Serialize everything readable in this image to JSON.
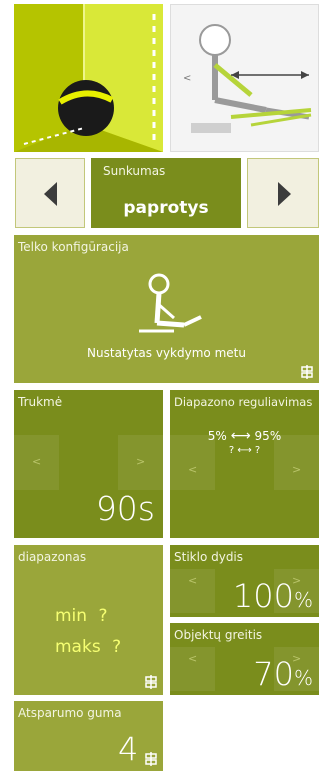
{
  "top_images": {
    "left_alt": "yellow-room-ball-illustration",
    "right_alt": "stick-figure-seated-exercise-illustration"
  },
  "difficulty": {
    "label": "Sunkumas",
    "value": "paprotys",
    "prev_icon": "triangle-left-icon",
    "next_icon": "triangle-right-icon"
  },
  "body_config": {
    "title": "Telko konfigūracija",
    "status": "Nustatytas vykdymo metu",
    "icon": "link-icon"
  },
  "duration": {
    "title": "Trukmė",
    "value": "90s",
    "prev": "<",
    "next": ">"
  },
  "range_adjust": {
    "title": "Diapazono reguliavimas",
    "line1_left": "5%",
    "line1_right": "95%",
    "line2_left": "?",
    "line2_right": "?",
    "prev": "<",
    "next": ">"
  },
  "range": {
    "title": "diapazonas",
    "min_label": "min",
    "min_value": "?",
    "max_label": "maks",
    "max_value": "?"
  },
  "glass_size": {
    "title": "Stiklo dydis",
    "value": "100",
    "unit": "%",
    "prev": "<",
    "next": ">"
  },
  "object_speed": {
    "title": "Objektų greitis",
    "value": "70",
    "unit": "%",
    "prev": "<",
    "next": ">"
  },
  "resistance_band": {
    "title": "Atsparumo guma",
    "value": "4"
  },
  "colors": {
    "olive": "#7a8d1c",
    "light_olive": "#9aa63a",
    "accent_yellow": "#f6ff72"
  }
}
